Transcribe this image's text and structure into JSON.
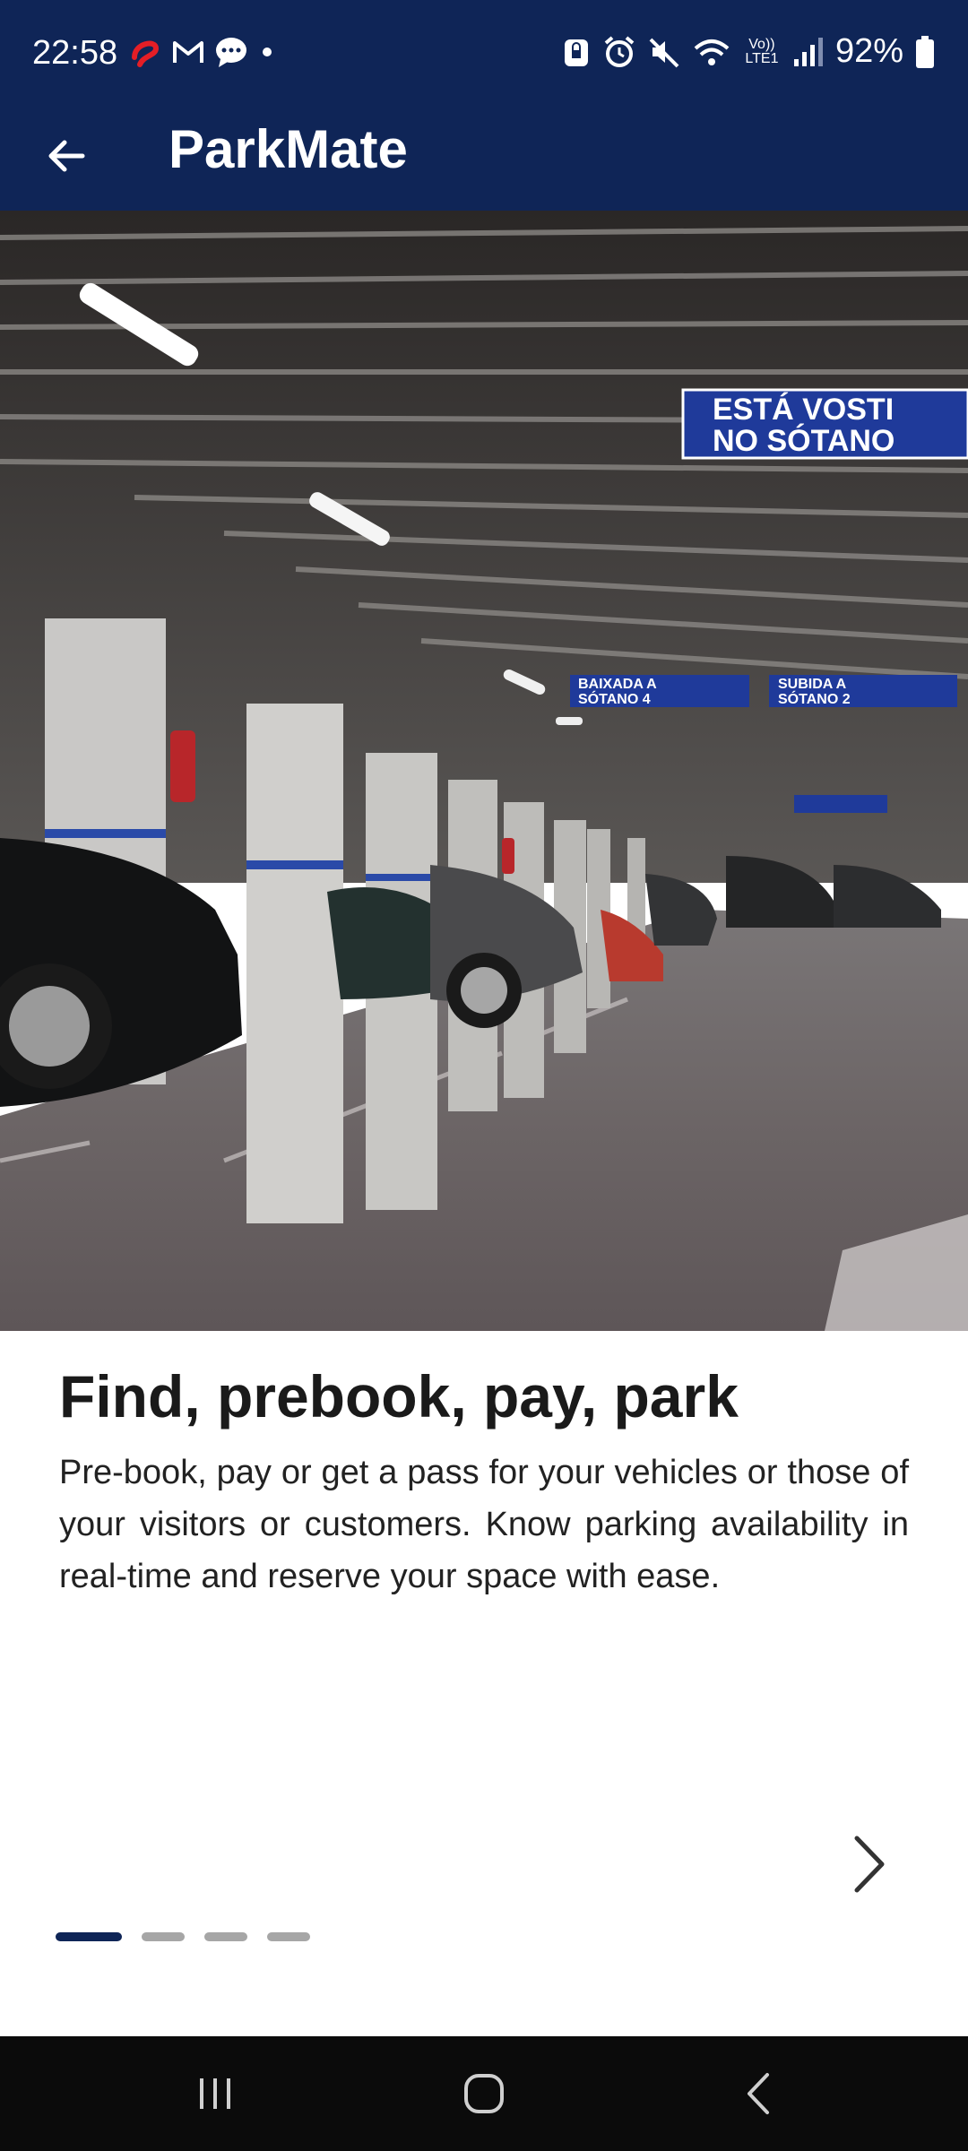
{
  "status_bar": {
    "time": "22:58",
    "notification_icons": [
      "airtel-icon",
      "gmail-icon",
      "chat-icon",
      "dot-icon"
    ],
    "system_icons": [
      "nfc-lock-icon",
      "alarm-icon",
      "mute-icon",
      "wifi-icon",
      "volte-icon",
      "signal-icon"
    ],
    "volte_label": "Vo)) LTE1",
    "battery_percent": "92%",
    "battery_level": 0.92
  },
  "app_bar": {
    "title": "ParkMate",
    "back_icon": "arrow-left-icon"
  },
  "hero": {
    "signs": [
      {
        "line1": "ESTÁ VOSTI",
        "line2": "NO SÓTANO"
      },
      {
        "line1": "BAIXADA A",
        "line2": "SÓTANO 4"
      },
      {
        "line1": "SUBIDA A",
        "line2": "SÓTANO 2"
      }
    ]
  },
  "onboarding": {
    "headline": "Find, prebook, pay, park",
    "description": "Pre-book, pay or get a pass for your vehicles or those of your visitors or customers. Know parking availability in real-time and reserve your space with ease.",
    "next_icon": "chevron-right-icon",
    "page_count": 4,
    "active_page": 1
  },
  "navigation_bar": {
    "buttons": [
      "recents-icon",
      "home-icon",
      "back-icon"
    ]
  },
  "colors": {
    "primary": "#0f2557",
    "dot_inactive": "#a6a6a6",
    "nav_bg": "#0b0b0b",
    "text": "#1a1a1a"
  }
}
